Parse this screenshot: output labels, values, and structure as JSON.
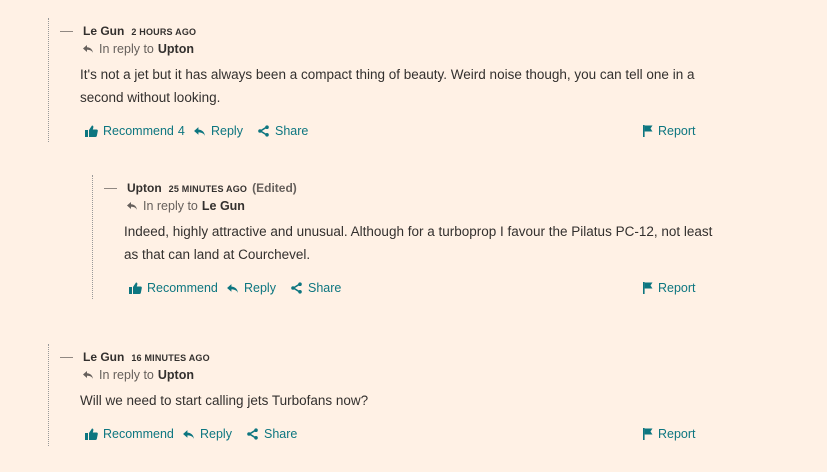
{
  "comments": [
    {
      "collapse": "—",
      "author": "Le Gun",
      "time": "2 HOURS AGO",
      "edited": "",
      "reply_prefix": "In reply to",
      "reply_target": "Upton",
      "text": "It's not a jet but it has always been a compact thing of beauty. Weird noise though, you can tell one in a second without looking.",
      "recommend_label": "Recommend",
      "recommend_count": "4",
      "reply_label": "Reply",
      "share_label": "Share",
      "report_label": "Report"
    },
    {
      "collapse": "—",
      "author": "Upton",
      "time": "25 MINUTES AGO",
      "edited": "(Edited)",
      "reply_prefix": "In reply to",
      "reply_target": "Le Gun",
      "text": "Indeed, highly attractive and unusual. Although for a turboprop I favour the Pilatus PC-12, not least as that can land at Courchevel.",
      "recommend_label": "Recommend",
      "recommend_count": "",
      "reply_label": "Reply",
      "share_label": "Share",
      "report_label": "Report"
    },
    {
      "collapse": "—",
      "author": "Le Gun",
      "time": "16 MINUTES AGO",
      "edited": "",
      "reply_prefix": "In reply to",
      "reply_target": "Upton",
      "text": "Will we need to start calling jets Turbofans now?",
      "recommend_label": "Recommend",
      "recommend_count": "",
      "reply_label": "Reply",
      "share_label": "Share",
      "report_label": "Report"
    }
  ],
  "icons": {
    "reply_arrow": "reply-arrow-icon",
    "thumbs_up": "thumbs-up-icon",
    "reply": "reply-icon",
    "share": "share-icon",
    "flag": "flag-icon"
  },
  "colors": {
    "background": "#fff1e5",
    "text": "#33302e",
    "accent": "#0d7680",
    "muted": "#66605c"
  }
}
